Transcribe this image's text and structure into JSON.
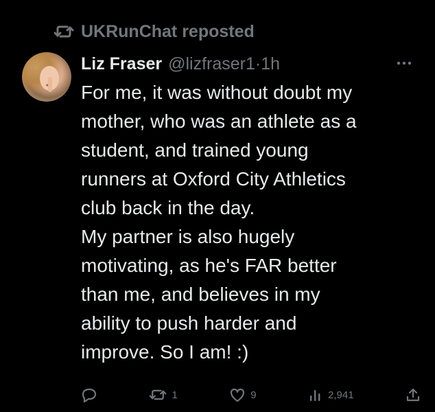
{
  "repost": {
    "label": "UKRunChat reposted",
    "icon": "repost-icon"
  },
  "post": {
    "author_name": "Liz Fraser",
    "author_handle": "@lizfraser1",
    "separator": "·",
    "time": "1h",
    "more_icon": "more-icon",
    "lines": [
      "For me, it was without doubt my",
      "mother, who was an athlete as a",
      "student, and trained young",
      "runners at Oxford City Athletics",
      "club back in the day.",
      "My partner is also hugely",
      "motivating, as he's FAR better",
      "than me, and believes in my",
      "ability to push harder and",
      "improve. So I am! :)"
    ]
  },
  "actions": {
    "reply": {
      "icon": "reply-icon",
      "count": ""
    },
    "repost": {
      "icon": "repost-icon",
      "count": "1"
    },
    "like": {
      "icon": "heart-icon",
      "count": "9"
    },
    "views": {
      "icon": "views-icon",
      "count": "2,941"
    },
    "share": {
      "icon": "share-icon"
    }
  },
  "colors": {
    "background": "#000000",
    "text": "#e7e9ea",
    "muted": "#71767b"
  }
}
